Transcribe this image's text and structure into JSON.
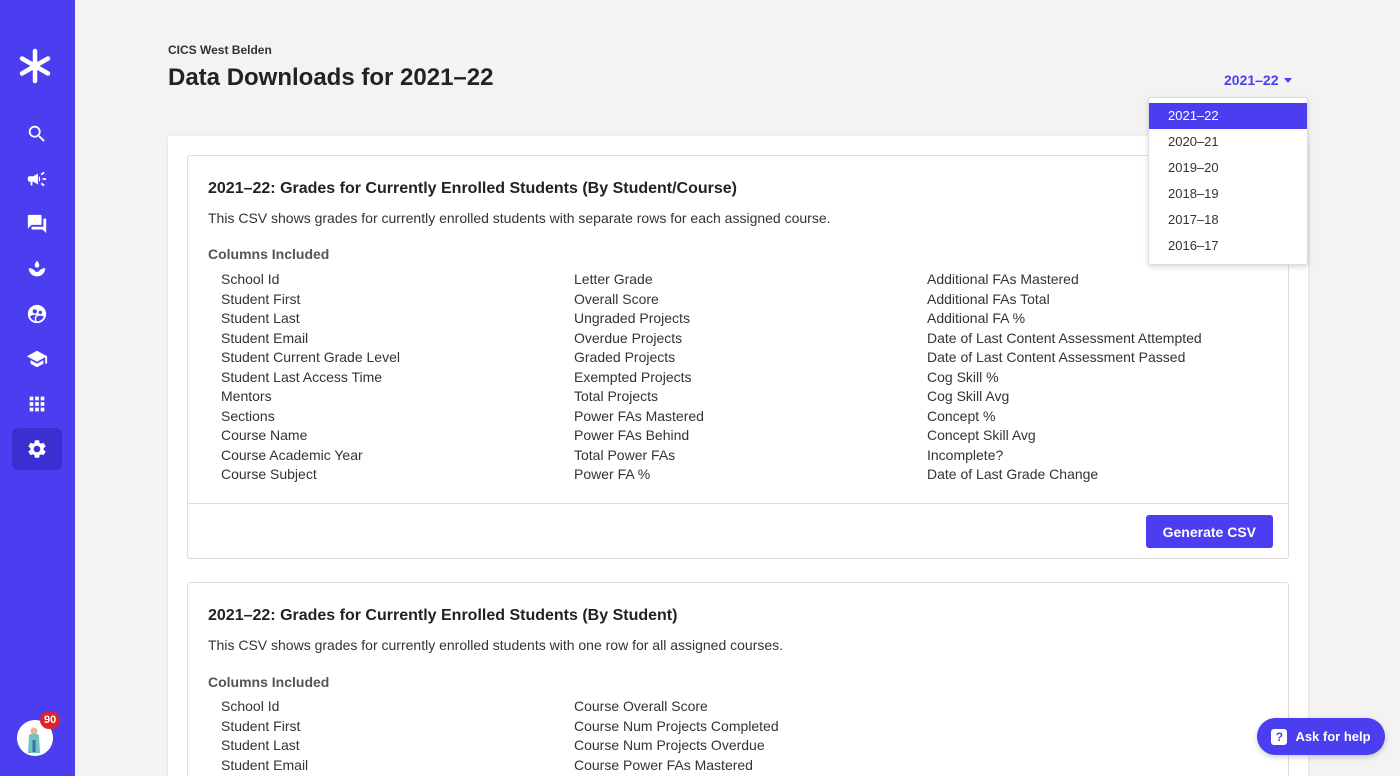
{
  "school_name": "CICS West Belden",
  "page_title": "Data Downloads for 2021–22",
  "year_selector": {
    "selected": "2021–22",
    "options": [
      "2021–22",
      "2020–21",
      "2019–20",
      "2018–19",
      "2017–18",
      "2016–17"
    ]
  },
  "sidebar": {
    "items": [
      "search-icon",
      "megaphone-icon",
      "chat-icon",
      "hand-seedling-icon",
      "community-icon",
      "graduation-cap-icon",
      "grid-icon",
      "gear-icon"
    ],
    "active": "gear-icon",
    "notification_count": "90"
  },
  "cards": [
    {
      "title": "2021–22: Grades for Currently Enrolled Students (By Student/Course)",
      "description": "This CSV shows grades for currently enrolled students with separate rows for each assigned course.",
      "columns_label": "Columns Included",
      "columns": [
        [
          "School Id",
          "Student First",
          "Student Last",
          "Student Email",
          "Student Current Grade Level",
          "Student Last Access Time",
          "Mentors",
          "Sections",
          "Course Name",
          "Course Academic Year",
          "Course Subject"
        ],
        [
          "Letter Grade",
          "Overall Score",
          "Ungraded Projects",
          "Overdue Projects",
          "Graded Projects",
          "Exempted Projects",
          "Total Projects",
          "Power FAs Mastered",
          "Power FAs Behind",
          "Total Power FAs",
          "Power FA %"
        ],
        [
          "Additional FAs Mastered",
          "Additional FAs Total",
          "Additional FA %",
          "Date of Last Content Assessment Attempted",
          "Date of Last Content Assessment Passed",
          "Cog Skill %",
          "Cog Skill Avg",
          "Concept %",
          "Concept Skill Avg",
          "Incomplete?",
          "Date of Last Grade Change"
        ]
      ],
      "button_label": "Generate CSV"
    },
    {
      "title": "2021–22: Grades for Currently Enrolled Students (By Student)",
      "description": "This CSV shows grades for currently enrolled students with one row for all assigned courses.",
      "columns_label": "Columns Included",
      "columns": [
        [
          "School Id",
          "Student First",
          "Student Last",
          "Student Email"
        ],
        [
          "Course Overall Score",
          "Course Num Projects Completed",
          "Course Num Projects Overdue",
          "Course Power FAs Mastered"
        ]
      ]
    }
  ],
  "help_button": "Ask for help",
  "accent_color": "#4b3ef0"
}
